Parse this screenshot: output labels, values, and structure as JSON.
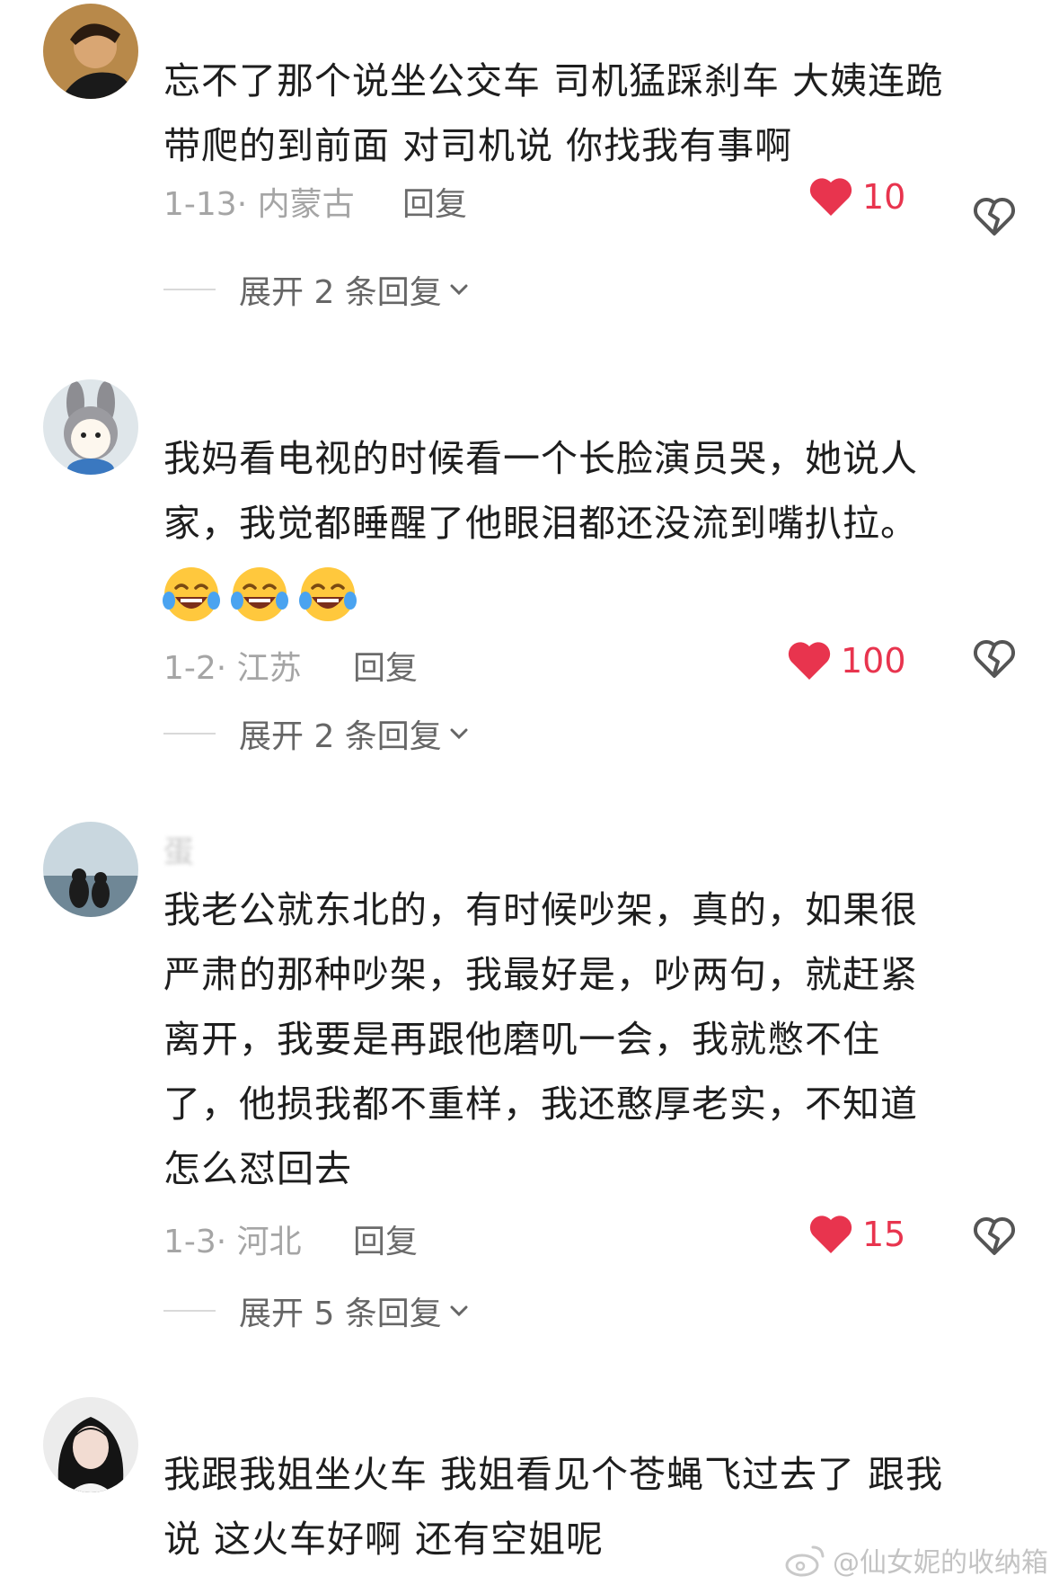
{
  "comments": [
    {
      "body_lines": [
        "忘不了那个说坐公交车 司机猛踩刹车 大姨连跪",
        "带爬的到前面 对司机说 你找我有事啊"
      ],
      "date_location": "1-13· 内蒙古",
      "reply_label": "回复",
      "likes": "10",
      "expand_label": "展开 2 条回复"
    },
    {
      "body_lines": [
        "我妈看电视的时候看一个长脸演员哭，她说人",
        "家，我觉都睡醒了他眼泪都还没流到嘴扒拉。"
      ],
      "emojis": [
        "laugh-cry-emoji",
        "laugh-cry-emoji",
        "laugh-cry-emoji"
      ],
      "date_location": "1-2· 江苏",
      "reply_label": "回复",
      "likes": "100",
      "expand_label": "展开 2 条回复"
    },
    {
      "username": "蛋",
      "body_lines": [
        "我老公就东北的，有时候吵架，真的，如果很",
        "严肃的那种吵架，我最好是，吵两句，就赶紧",
        "离开，我要是再跟他磨叽一会，我就憋不住",
        "了，他损我都不重样，我还憨厚老实，不知道",
        "怎么怼回去"
      ],
      "date_location": "1-3· 河北",
      "reply_label": "回复",
      "likes": "15",
      "expand_label": "展开 5 条回复"
    },
    {
      "body_lines": [
        "我跟我姐坐火车 我姐看见个苍蝇飞过去了 跟我",
        "说 这火车好啊 还有空姐呢"
      ]
    }
  ],
  "watermark": "@仙女妮的收纳箱",
  "colors": {
    "like": "#e8344e",
    "meta": "#a5a5a5",
    "body": "#1e1e1e"
  }
}
